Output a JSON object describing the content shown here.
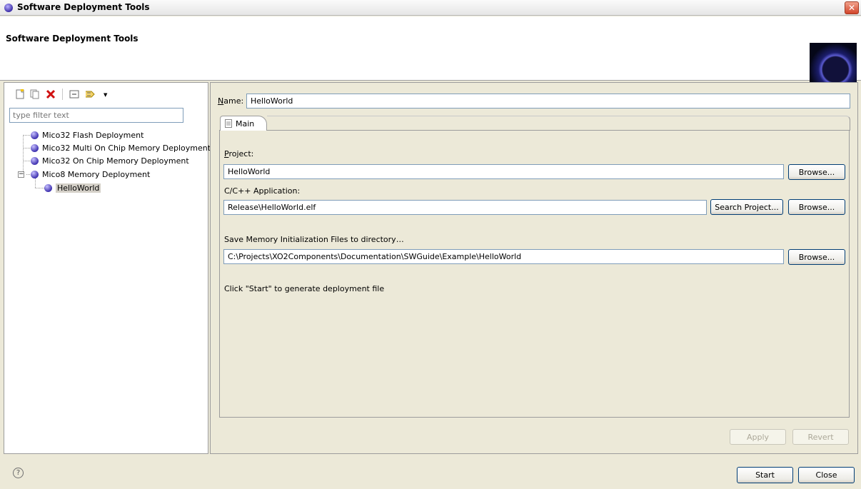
{
  "window": {
    "title": "Software Deployment Tools",
    "close_glyph": "✕"
  },
  "header": {
    "title": "Software Deployment Tools"
  },
  "toolbar": {
    "icons": [
      "new-config-icon",
      "duplicate-icon",
      "delete-icon",
      "collapse-all-icon",
      "filter-icon"
    ]
  },
  "filter": {
    "placeholder": "type filter text"
  },
  "tree": {
    "items": [
      {
        "label": "Mico32 Flash Deployment"
      },
      {
        "label": "Mico32 Multi On Chip Memory Deployment"
      },
      {
        "label": "Mico32 On Chip Memory Deployment"
      },
      {
        "label": "Mico8 Memory Deployment"
      },
      {
        "label": "HelloWorld"
      }
    ]
  },
  "form": {
    "name_label": "Name:",
    "name_value": "HelloWorld",
    "tab_main": "Main",
    "project_label": "Project:",
    "project_value": "HelloWorld",
    "app_label": "C/C++ Application:",
    "app_value": "Release\\HelloWorld.elf",
    "memdir_label": "Save Memory Initialization Files to directory…",
    "memdir_value": "C:\\Projects\\XO2Components\\Documentation\\SWGuide\\Example\\HelloWorld",
    "hint": "Click \"Start\" to generate deployment file"
  },
  "buttons": {
    "browse": "Browse...",
    "search_project": "Search Project...",
    "apply": "Apply",
    "revert": "Revert",
    "start": "Start",
    "close": "Close"
  },
  "help": {
    "glyph": "?"
  }
}
